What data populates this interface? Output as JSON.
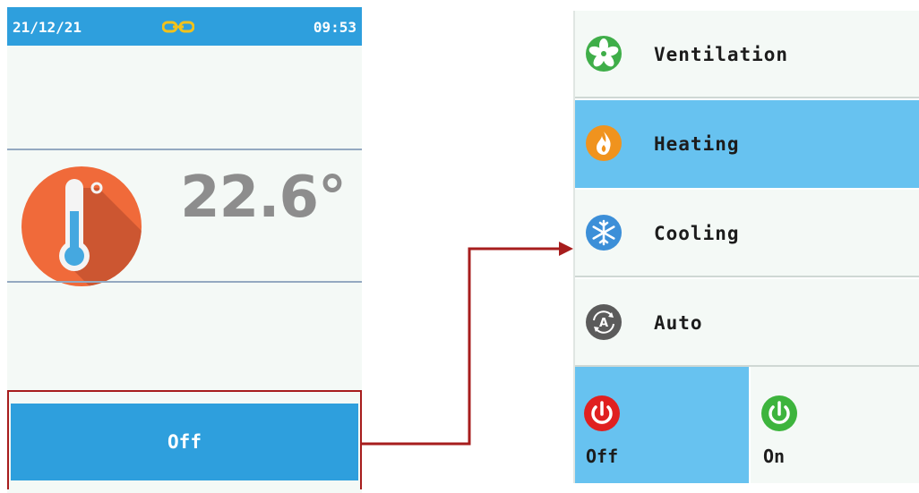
{
  "status_bar": {
    "date": "21/12/21",
    "time": "09:53",
    "link_icon": "chain-link-icon"
  },
  "temperature": {
    "value": "22.6°",
    "icon": "thermometer-icon"
  },
  "mode_button": {
    "label": "Off"
  },
  "menu": {
    "items": [
      {
        "label": "Ventilation",
        "icon": "fan-icon",
        "selected": false
      },
      {
        "label": "Heating",
        "icon": "flame-icon",
        "selected": true
      },
      {
        "label": "Cooling",
        "icon": "snowflake-icon",
        "selected": false
      },
      {
        "label": "Auto",
        "icon": "auto-mode-icon",
        "selected": false
      }
    ]
  },
  "power": {
    "off_label": "Off",
    "on_label": "On",
    "selected": "off"
  },
  "colors": {
    "primary_blue": "#2e9fdd",
    "selected_blue": "#67c2f0",
    "highlight_red": "#a71d1d",
    "power_off_red": "#e02020",
    "power_on_green": "#3db43d"
  }
}
